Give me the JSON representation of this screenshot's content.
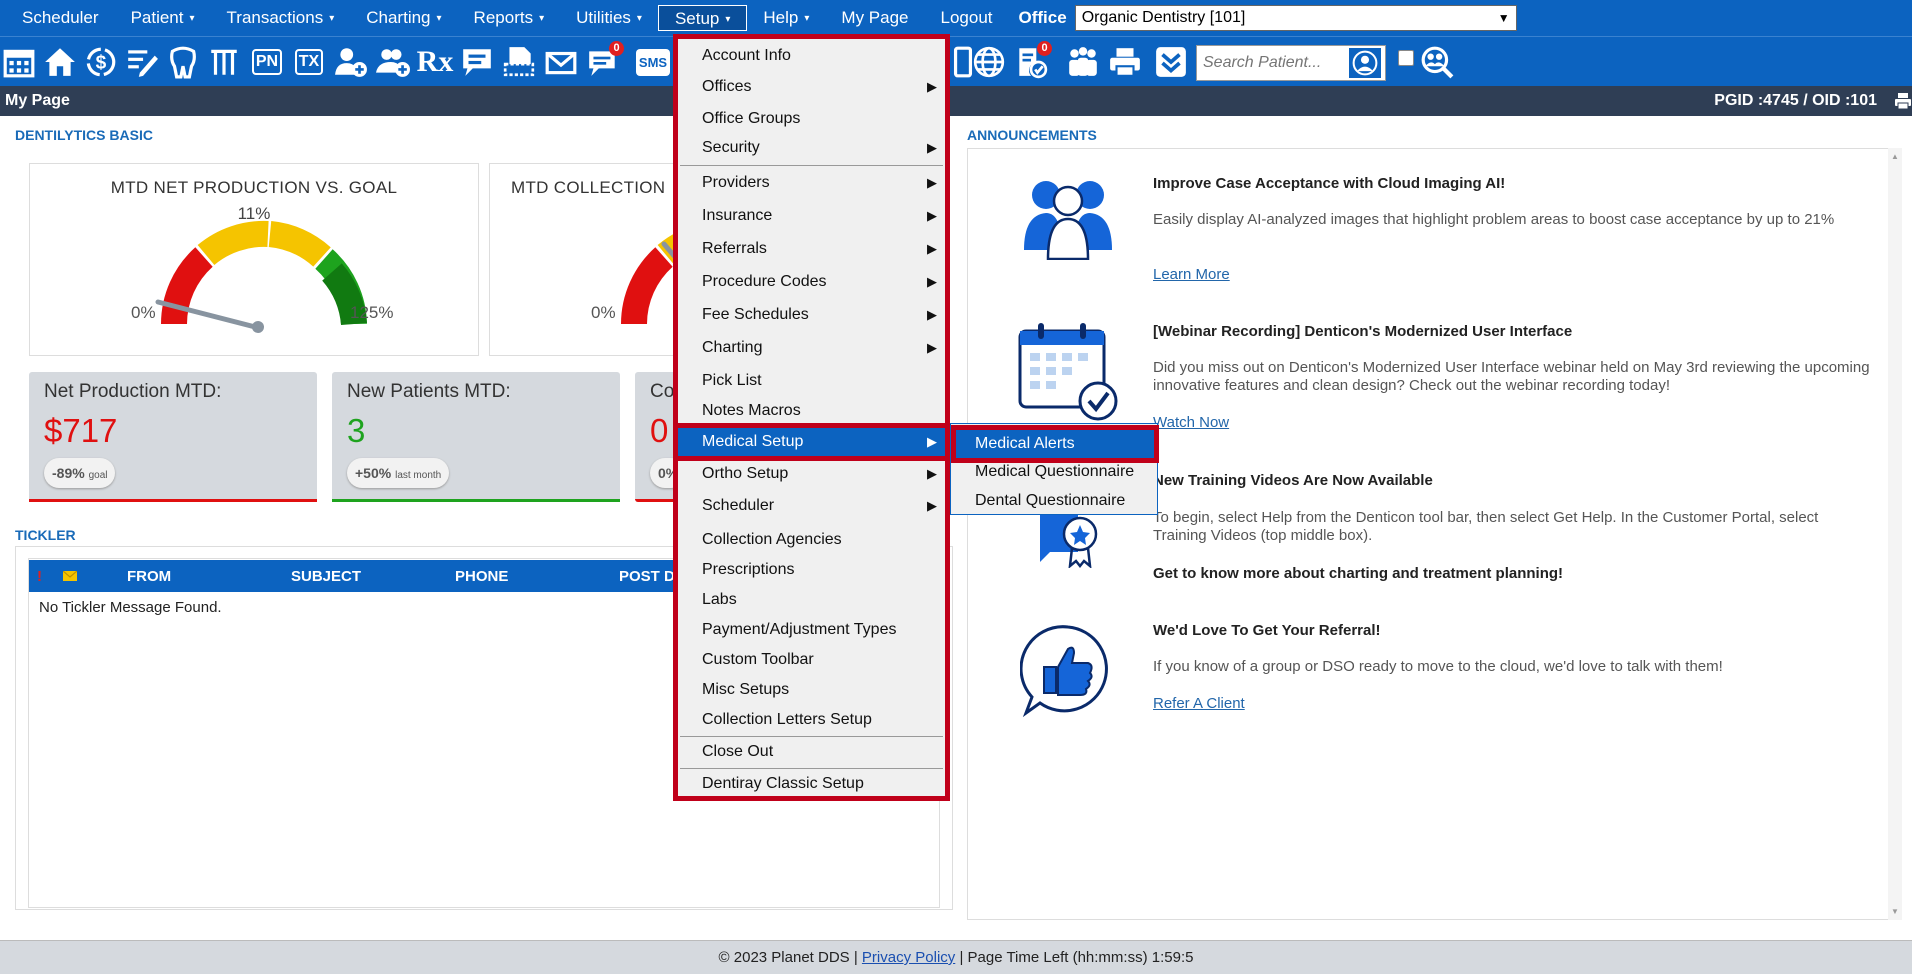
{
  "menubar": {
    "items": [
      {
        "label": "Scheduler",
        "caret": false
      },
      {
        "label": "Patient",
        "caret": true
      },
      {
        "label": "Transactions",
        "caret": true
      },
      {
        "label": "Charting",
        "caret": true
      },
      {
        "label": "Reports",
        "caret": true
      },
      {
        "label": "Utilities",
        "caret": true
      },
      {
        "label": "Setup",
        "caret": true
      },
      {
        "label": "Help",
        "caret": true
      },
      {
        "label": "My Page",
        "caret": false
      },
      {
        "label": "Logout",
        "caret": false
      }
    ],
    "caret_glyph": "▾",
    "office_label": "Office",
    "office_value": "Organic Dentistry [101]"
  },
  "toolbar": {
    "pn_label": "PN",
    "tx_label": "TX",
    "rx_label": "Rx",
    "sms_label": "SMS",
    "msg_badge": "0",
    "note_badge": "0",
    "search_placeholder": "Search Patient..."
  },
  "pagebar": {
    "title": "My Page",
    "ids": "PGID :4745  /  OID :101"
  },
  "dentilytics": {
    "section_title": "DENTILYTICS BASIC",
    "gauges": [
      {
        "title": "MTD NET PRODUCTION VS. GOAL",
        "pct_label": "11%",
        "min_label": "0%",
        "max_label": "125%",
        "value_pct": 11
      },
      {
        "title": "MTD COLLECTION",
        "min_label": "0%"
      }
    ],
    "stats": [
      {
        "label": "Net Production MTD:",
        "value": "$717",
        "delta": "-89%",
        "delta_note": "goal",
        "color": "#e01010",
        "bar": "#e01010"
      },
      {
        "label": "New Patients MTD:",
        "value": "3",
        "delta": "+50%",
        "delta_note": "last month",
        "color": "#1ea31e",
        "bar": "#1ea31e"
      },
      {
        "label": "Co",
        "value": "0",
        "delta": "0%",
        "delta_note": "",
        "color": "#e01010",
        "bar": "#e01010"
      }
    ]
  },
  "tickler": {
    "section_title": "TICKLER",
    "columns": [
      "FROM",
      "SUBJECT",
      "PHONE",
      "POST D"
    ],
    "empty_message": "No Tickler Message Found."
  },
  "announcements": {
    "section_title": "ANNOUNCEMENTS",
    "items": [
      {
        "title": "Improve Case Acceptance with Cloud Imaging AI!",
        "body": "Easily display AI-analyzed images that highlight problem areas to boost case acceptance by up to 21%",
        "link": "Learn More"
      },
      {
        "title": "[Webinar Recording] Denticon's Modernized User Interface",
        "body": "Did you miss out on Denticon's Modernized User Interface webinar held on May 3rd reviewing the upcoming innovative features and clean design? Check out the webinar recording today!",
        "link": "Watch Now"
      },
      {
        "title": "New Training Videos Are Now Available",
        "body": "To begin, select Help from the Denticon tool bar, then select Get Help. In the Customer Portal, select Training Videos (top middle box).",
        "extra": "Get to know more about charting and treatment planning!"
      },
      {
        "title": "We'd Love To Get Your Referral!",
        "body": "If you know of a group or DSO ready to move to the cloud, we'd love to talk with them!",
        "link": "Refer A Client"
      }
    ]
  },
  "setup_menu": {
    "items": [
      {
        "label": "Account Info",
        "arrow": false
      },
      {
        "label": "Offices",
        "arrow": true
      },
      {
        "label": "Office Groups",
        "arrow": false
      },
      {
        "label": "Security",
        "arrow": true
      },
      {
        "label": "Providers",
        "arrow": true
      },
      {
        "label": "Insurance",
        "arrow": true
      },
      {
        "label": "Referrals",
        "arrow": true
      },
      {
        "label": "Procedure Codes",
        "arrow": true
      },
      {
        "label": "Fee Schedules",
        "arrow": true
      },
      {
        "label": "Charting",
        "arrow": true
      },
      {
        "label": "Pick List",
        "arrow": false
      },
      {
        "label": "Notes Macros",
        "arrow": false
      },
      {
        "label": "Medical Setup",
        "arrow": true
      },
      {
        "label": "Ortho Setup",
        "arrow": true
      },
      {
        "label": "Scheduler",
        "arrow": true
      },
      {
        "label": "Collection Agencies",
        "arrow": false
      },
      {
        "label": "Prescriptions",
        "arrow": false
      },
      {
        "label": "Labs",
        "arrow": false
      },
      {
        "label": "Payment/Adjustment Types",
        "arrow": false
      },
      {
        "label": "Custom Toolbar",
        "arrow": false
      },
      {
        "label": "Misc Setups",
        "arrow": false
      },
      {
        "label": "Collection Letters Setup",
        "arrow": false
      },
      {
        "label": "Close Out",
        "arrow": false
      },
      {
        "label": "Dentiray Classic Setup",
        "arrow": false
      }
    ],
    "arrow_glyph": "▶",
    "highlighted": "Medical Setup"
  },
  "medical_submenu": {
    "items": [
      "Medical Alerts",
      "Medical Questionnaire",
      "Dental Questionnaire"
    ],
    "highlighted": "Medical Alerts"
  },
  "footer": {
    "copyright": "© 2023 Planet DDS |",
    "privacy": "Privacy Policy",
    "time_left": "|  Page Time Left (hh:mm:ss) 1:59:5"
  },
  "colors": {
    "brand_blue": "#0c63c0",
    "header_dark": "#2f3e55",
    "highlight_red": "#c0001a"
  }
}
